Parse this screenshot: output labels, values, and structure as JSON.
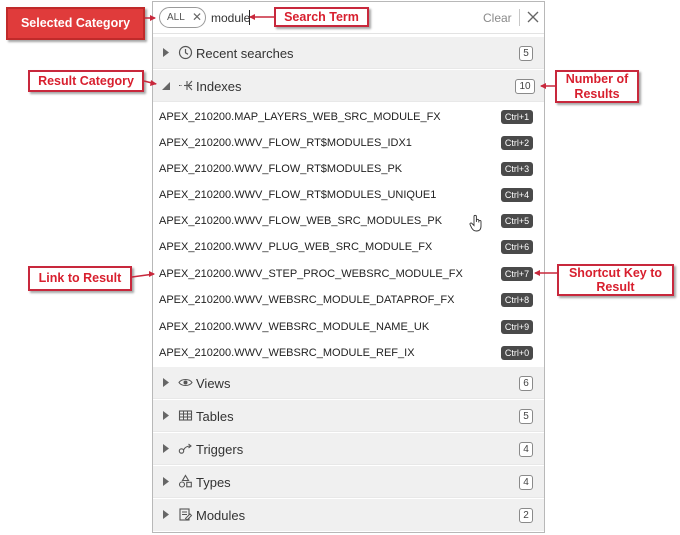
{
  "search": {
    "filter_label": "ALL",
    "query": "module",
    "clear_label": "Clear"
  },
  "categories": [
    {
      "label": "Recent searches",
      "count": "5",
      "icon": "clock-icon",
      "expanded": false
    },
    {
      "label": "Indexes",
      "count": "10",
      "icon": "index-icon",
      "expanded": true
    },
    {
      "label": "Views",
      "count": "6",
      "icon": "eye-icon",
      "expanded": false
    },
    {
      "label": "Tables",
      "count": "5",
      "icon": "table-icon",
      "expanded": false
    },
    {
      "label": "Triggers",
      "count": "4",
      "icon": "trigger-icon",
      "expanded": false
    },
    {
      "label": "Types",
      "count": "4",
      "icon": "shapes-icon",
      "expanded": false
    },
    {
      "label": "Modules",
      "count": "2",
      "icon": "module-icon",
      "expanded": false
    }
  ],
  "results": [
    {
      "name": "APEX_210200.MAP_LAYERS_WEB_SRC_MODULE_FX",
      "shortcut": "Ctrl+1"
    },
    {
      "name": "APEX_210200.WWV_FLOW_RT$MODULES_IDX1",
      "shortcut": "Ctrl+2"
    },
    {
      "name": "APEX_210200.WWV_FLOW_RT$MODULES_PK",
      "shortcut": "Ctrl+3"
    },
    {
      "name": "APEX_210200.WWV_FLOW_RT$MODULES_UNIQUE1",
      "shortcut": "Ctrl+4"
    },
    {
      "name": "APEX_210200.WWV_FLOW_WEB_SRC_MODULES_PK",
      "shortcut": "Ctrl+5"
    },
    {
      "name": "APEX_210200.WWV_PLUG_WEB_SRC_MODULE_FX",
      "shortcut": "Ctrl+6"
    },
    {
      "name": "APEX_210200.WWV_STEP_PROC_WEBSRC_MODULE_FX",
      "shortcut": "Ctrl+7"
    },
    {
      "name": "APEX_210200.WWV_WEBSRC_MODULE_DATAPROF_FX",
      "shortcut": "Ctrl+8"
    },
    {
      "name": "APEX_210200.WWV_WEBSRC_MODULE_NAME_UK",
      "shortcut": "Ctrl+9"
    },
    {
      "name": "APEX_210200.WWV_WEBSRC_MODULE_REF_IX",
      "shortcut": "Ctrl+0"
    }
  ],
  "callouts": {
    "selected_category": "Selected Category",
    "search_term": "Search Term",
    "result_category": "Result Category",
    "number_of_results": "Number of Results",
    "link_to_result": "Link to Result",
    "shortcut_key": "Shortcut Key to Result"
  },
  "colors": {
    "callout_border": "#c8283c",
    "callout_text": "#d81f2e",
    "shortcut_bg": "#4a4a4a",
    "category_bg": "#f0f0f0"
  }
}
